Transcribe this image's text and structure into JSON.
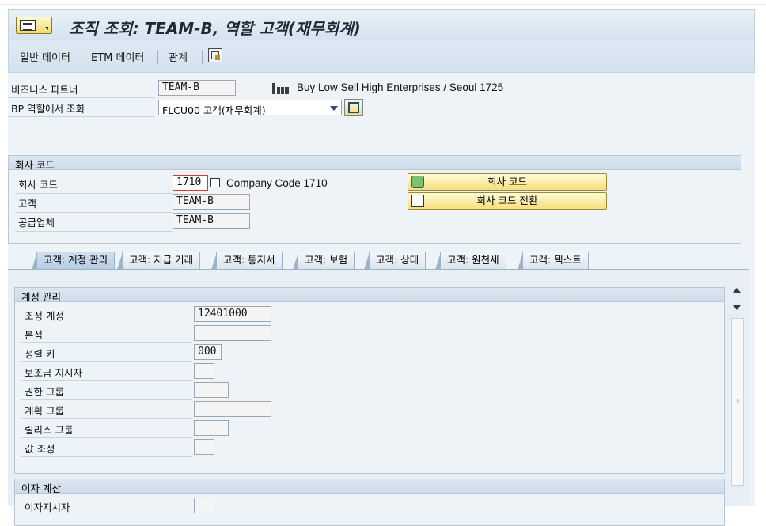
{
  "title": "조직 조회: TEAM-B, 역할 고객(재무회계)",
  "toolbar": {
    "items": [
      "일반 데이터",
      "ETM 데이터",
      "관계"
    ],
    "icon": "display-icon"
  },
  "header": {
    "bp_label": "비즈니스 파트너",
    "bp_value": "TEAM-B",
    "bp_description": "Buy Low Sell High Enterprises / Seoul 1725",
    "role_label": "BP 역할에서 조회",
    "role_value": "FLCU00 고객(재무회계)"
  },
  "company_group": {
    "title": "회사 코드",
    "company_code_label": "회사 코드",
    "company_code_value": "1710",
    "company_code_desc": "Company Code 1710",
    "customer_label": "고객",
    "customer_value": "TEAM-B",
    "vendor_label": "공급업체",
    "vendor_value": "TEAM-B",
    "button_company_code": "회사 코드",
    "button_switch": "회사 코드 전환"
  },
  "tabs": [
    "고객: 계정 관리",
    "고객: 지급 거래",
    "고객: 통지서",
    "고객: 보험",
    "고객: 상태",
    "고객: 원천세",
    "고객: 텍스트"
  ],
  "account_mgmt": {
    "title": "계정 관리",
    "fields": [
      {
        "label": "조정 계정",
        "value": "12401000"
      },
      {
        "label": "본점",
        "value": ""
      },
      {
        "label": "정렬 키",
        "value": "000"
      },
      {
        "label": "보조금 지시자",
        "value": ""
      },
      {
        "label": "권한 그룹",
        "value": ""
      },
      {
        "label": "계획 그룹",
        "value": ""
      },
      {
        "label": "릴리스 그룹",
        "value": ""
      },
      {
        "label": "값 조정",
        "value": ""
      }
    ]
  },
  "interest": {
    "title": "이자 계산",
    "first_label": "이자지시자"
  },
  "colors": {
    "accent": "#f6df7d",
    "panel": "#eef3f8"
  }
}
